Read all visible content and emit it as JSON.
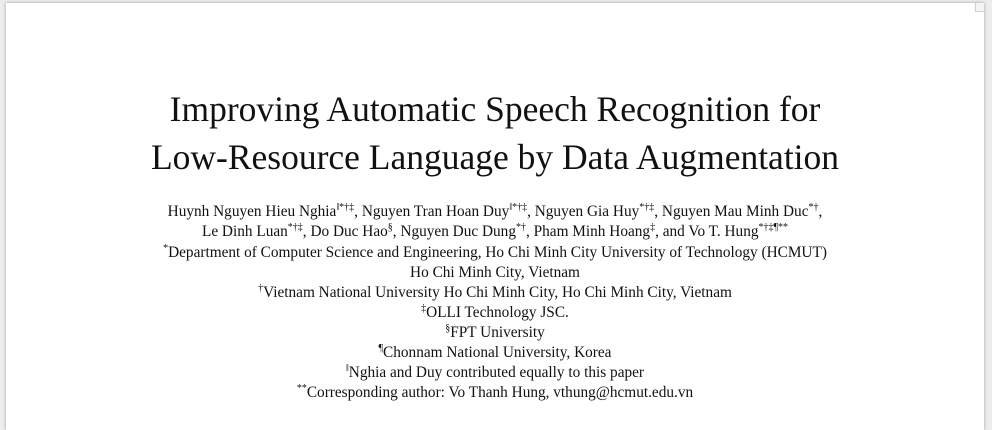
{
  "title": {
    "line1": "Improving Automatic Speech Recognition for",
    "line2": "Low-Resource Language by Data Augmentation"
  },
  "authors": [
    {
      "name": "Huynh Nguyen Hieu Nghia",
      "marks": "‖*†‡",
      "sep": ", "
    },
    {
      "name": "Nguyen Tran Hoan Duy",
      "marks": "‖*†‡",
      "sep": ", "
    },
    {
      "name": "Nguyen Gia Huy",
      "marks": "*†‡",
      "sep": ", "
    },
    {
      "name": "Nguyen Mau Minh Duc",
      "marks": "*†",
      "sep": ","
    },
    {
      "name": "Le Dinh Luan",
      "marks": "*†‡",
      "sep": ", "
    },
    {
      "name": "Do Duc Hao",
      "marks": "§",
      "sep": ", "
    },
    {
      "name": "Nguyen Duc Dung",
      "marks": "*†",
      "sep": ", "
    },
    {
      "name": "Pham Minh Hoang",
      "marks": "‡",
      "sep": ", and "
    },
    {
      "name": "Vo T. Hung",
      "marks": "*†‡¶**",
      "sep": ""
    }
  ],
  "affiliations": [
    {
      "mark": "*",
      "text": "Department of Computer Science and Engineering, Ho Chi Minh City University of Technology (HCMUT)"
    },
    {
      "mark": "",
      "text": "Ho Chi Minh City, Vietnam"
    },
    {
      "mark": "†",
      "text": "Vietnam National University Ho Chi Minh City, Ho Chi Minh City, Vietnam"
    },
    {
      "mark": "‡",
      "text": "OLLI Technology JSC."
    },
    {
      "mark": "§",
      "text": "FPT University"
    },
    {
      "mark": "¶",
      "text": "Chonnam National University, Korea"
    },
    {
      "mark": "‖",
      "text": "Nghia and Duy contributed equally to this paper"
    },
    {
      "mark": "**",
      "text": "Corresponding author: Vo Thanh Hung, vthung@hcmut.edu.vn"
    }
  ]
}
